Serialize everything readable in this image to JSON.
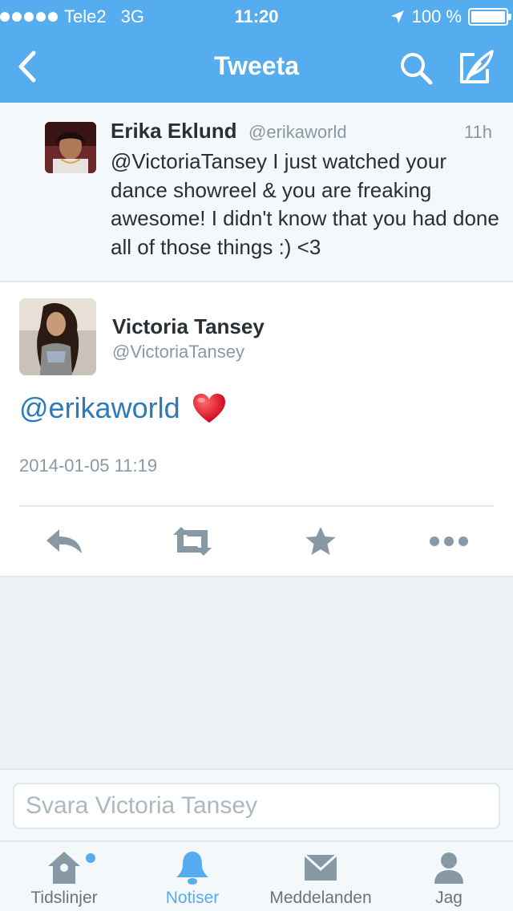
{
  "status_bar": {
    "carrier": "Tele2",
    "network": "3G",
    "time": "11:20",
    "battery": "100 %",
    "battery_level": 1.0
  },
  "nav": {
    "title": "Tweeta",
    "back_icon": "chevron-left-icon",
    "search_icon": "search-icon",
    "compose_icon": "compose-icon"
  },
  "original_tweet": {
    "name": "Erika Eklund",
    "handle": "@erikaworld",
    "time": "11h",
    "text": "@VictoriaTansey I just watched your dance showreel & you are freaking awesome! I didn't know that you had done all of those things :) <3"
  },
  "focus_tweet": {
    "name": "Victoria Tansey",
    "handle": "@VictoriaTansey",
    "mention": "@erikaworld",
    "emoji_icon": "heart-icon",
    "timestamp": "2014-01-05 11:19",
    "actions": [
      "reply-icon",
      "retweet-icon",
      "favorite-icon",
      "more-icon"
    ]
  },
  "reply": {
    "placeholder": "Svara Victoria Tansey"
  },
  "tabs": [
    {
      "label": "Tidslinjer",
      "icon": "home-icon",
      "has_badge": true
    },
    {
      "label": "Notiser",
      "icon": "bell-icon",
      "active": true
    },
    {
      "label": "Meddelanden",
      "icon": "envelope-icon"
    },
    {
      "label": "Jag",
      "icon": "person-icon"
    }
  ],
  "colors": {
    "accent": "#55acee",
    "link": "#2b7bb9",
    "text": "#292f33",
    "muted": "#8899a6",
    "icon_gray": "#8899a6",
    "heart": "#e0245e"
  }
}
